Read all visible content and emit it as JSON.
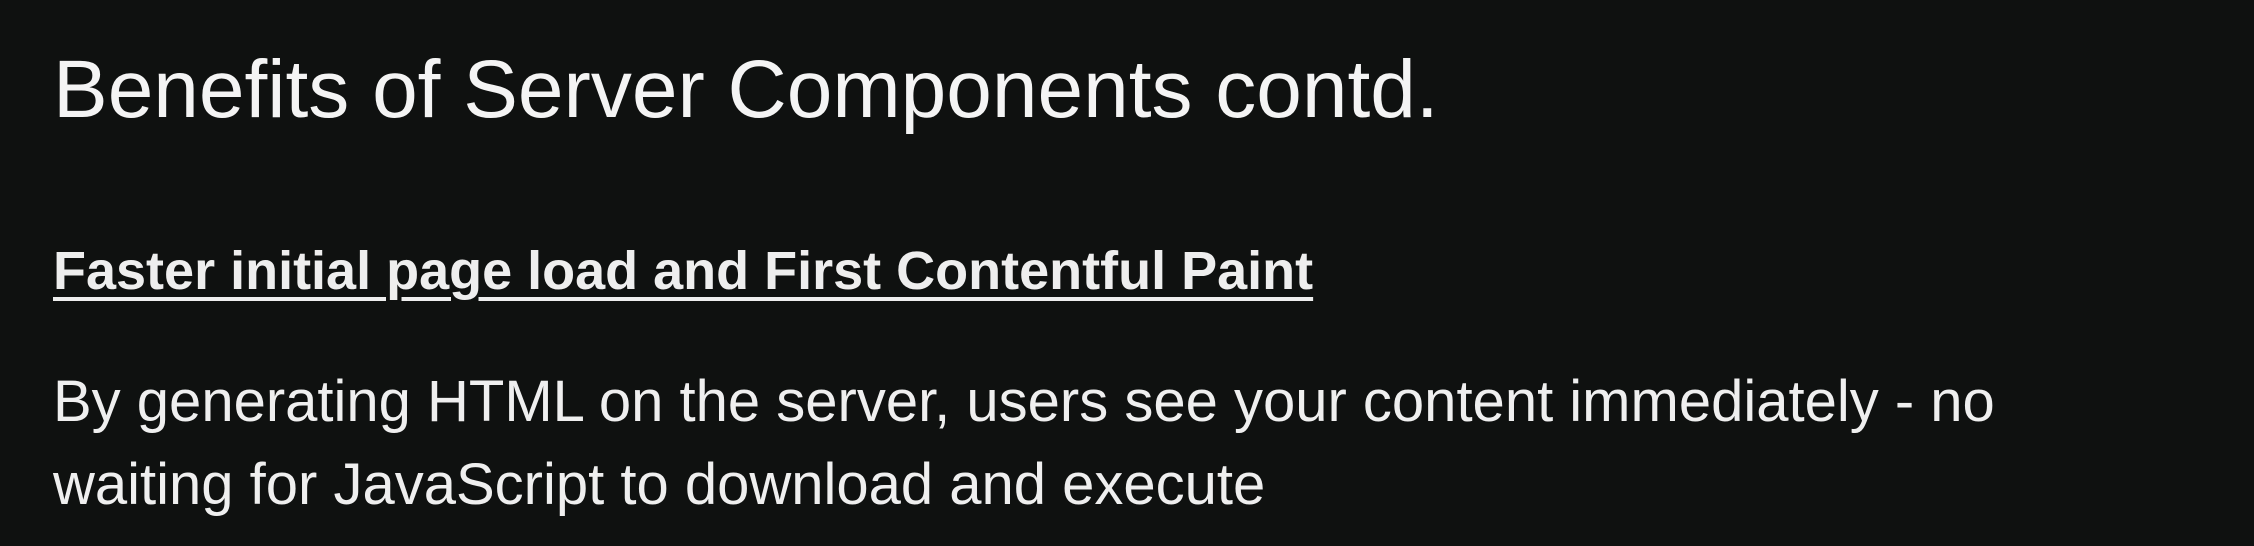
{
  "slide": {
    "title": "Benefits of Server Components contd.",
    "subheading": "Faster initial page load and First Contentful Paint",
    "body_line1": "By generating HTML on the server, users see your content immediately - no",
    "body_line2": "waiting for JavaScript to download and execute"
  }
}
